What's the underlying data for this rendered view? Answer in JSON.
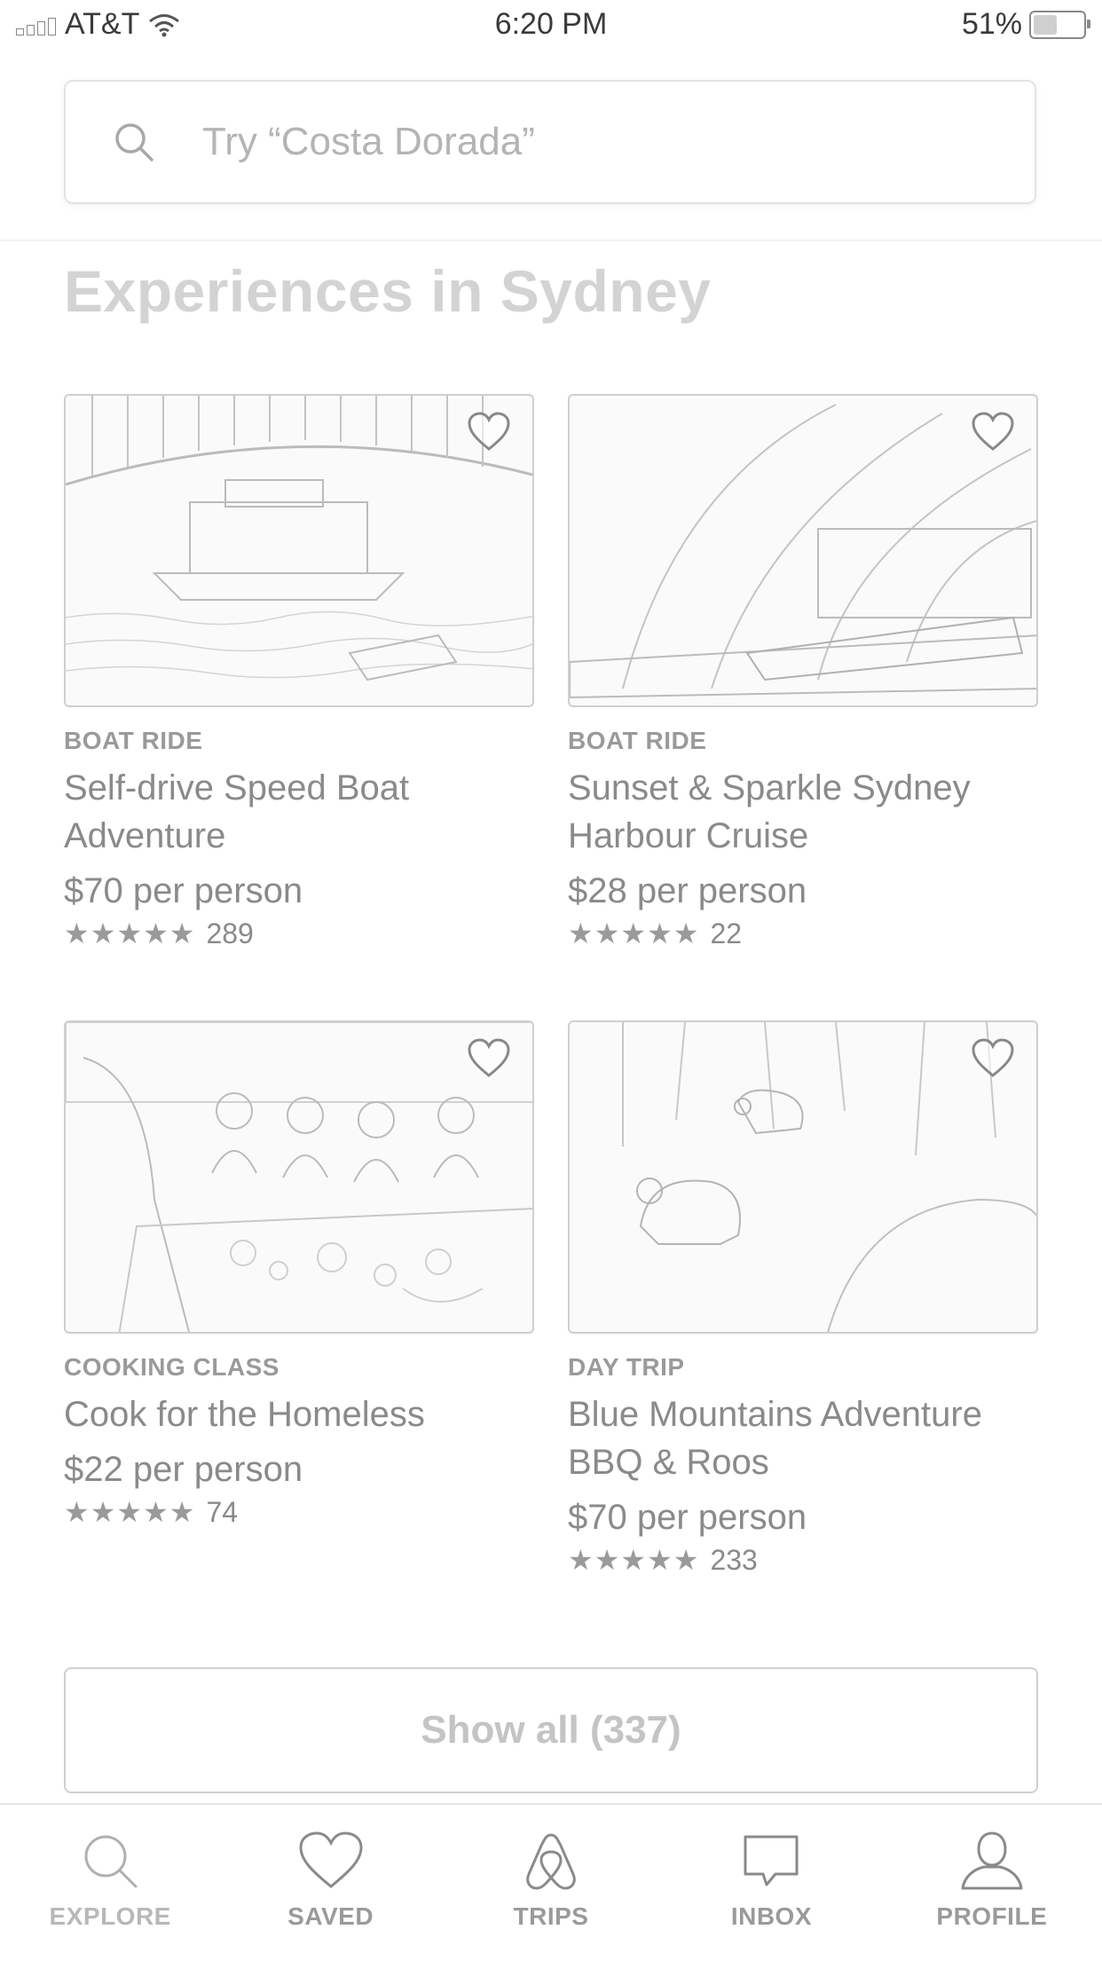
{
  "status": {
    "carrier": "AT&T",
    "time": "6:20 PM",
    "battery": "51%",
    "battery_level": 0.51
  },
  "search": {
    "placeholder": "Try “Costa Dorada”"
  },
  "section": {
    "title": "Experiences in Sydney"
  },
  "cards": [
    {
      "category": "BOAT RIDE",
      "name": "Self-drive Speed Boat Adventure",
      "price": "$70 per person",
      "stars": "★★★★★",
      "reviews": "289",
      "image": "speed-boat-harbour-bridge"
    },
    {
      "category": "BOAT RIDE",
      "name": "Sunset & Sparkle Sydney Harbour Cruise",
      "price": "$28 per person",
      "stars": "★★★★★",
      "reviews": "22",
      "image": "opera-house-cruise"
    },
    {
      "category": "COOKING CLASS",
      "name": "Cook for the Homeless",
      "price": "$22 per person",
      "stars": "★★★★★",
      "reviews": "74",
      "image": "group-cooking"
    },
    {
      "category": "DAY TRIP",
      "name": "Blue Mountains Adventure BBQ & Roos",
      "price": "$70 per person",
      "stars": "★★★★★",
      "reviews": "233",
      "image": "kangaroos-in-bush"
    }
  ],
  "show_all": {
    "label": "Show all (337)"
  },
  "tabs": [
    {
      "label": "EXPLORE",
      "icon": "search-icon",
      "active": true
    },
    {
      "label": "SAVED",
      "icon": "heart-icon",
      "active": false
    },
    {
      "label": "TRIPS",
      "icon": "airbnb-logo-icon",
      "active": false
    },
    {
      "label": "INBOX",
      "icon": "chat-bubble-icon",
      "active": false
    },
    {
      "label": "PROFILE",
      "icon": "profile-icon",
      "active": false
    }
  ]
}
